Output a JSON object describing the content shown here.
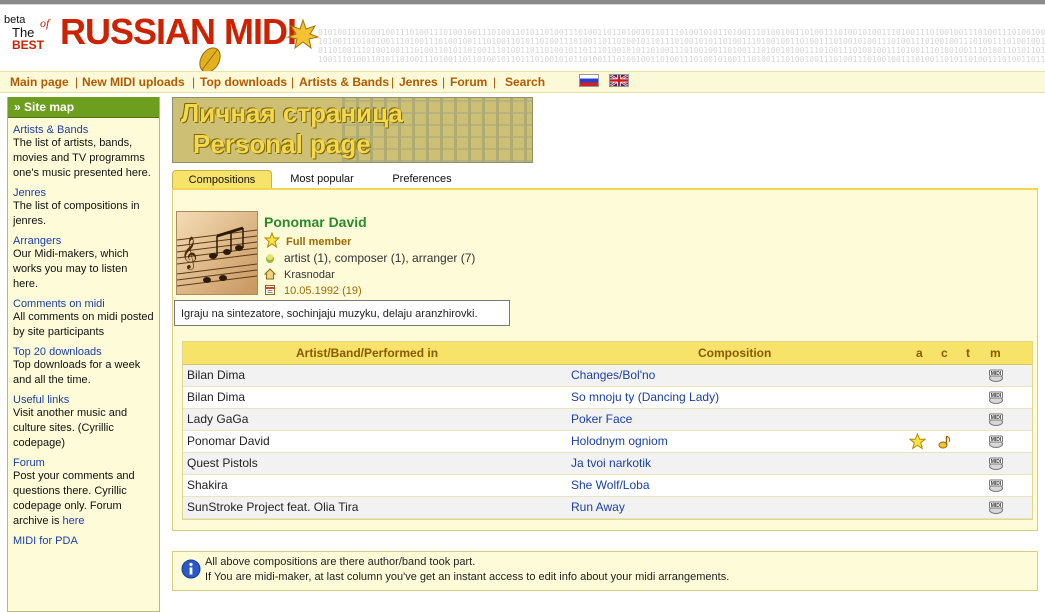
{
  "header": {
    "beta": "beta",
    "the": "The",
    "of": "of",
    "best": "BEST",
    "title": "RUSSIAN MIDI"
  },
  "nav": {
    "items": [
      "Main page",
      "New MIDI uploads",
      "Top downloads",
      "Artists & Bands",
      "Jenres",
      "Forum",
      "Search"
    ],
    "flags": [
      "ru-flag-icon",
      "uk-flag-icon"
    ]
  },
  "sidebar": {
    "title": "» Site map",
    "items": [
      {
        "title": "Artists & Bands",
        "desc": "The list of artists, bands, movies and TV programms one's music presented here."
      },
      {
        "title": "Jenres",
        "desc": "The list of compositions in jenres."
      },
      {
        "title": "Arrangers",
        "desc": "Our Midi-makers, which works you may to listen here."
      },
      {
        "title": "Comments on midi",
        "desc": "All comments on midi posted by site participants"
      },
      {
        "title": "Top 20 downloads",
        "desc": "Top downloads for a week and all the time."
      },
      {
        "title": "Useful links",
        "desc": "Visit another music and culture sites. (Cyrillic codepage)"
      },
      {
        "title": "Forum",
        "desc_pre": "Post your comments and questions there. Cyrillic codepage only. Forum archive is",
        "desc_link": "here"
      },
      {
        "title": "MIDI for PDA",
        "desc": ""
      }
    ]
  },
  "banner": {
    "ru": "Личная страница",
    "en": "Personal page"
  },
  "tabs": [
    "Compositions",
    "Most popular",
    "Preferences"
  ],
  "profile": {
    "name": "Ponomar David",
    "status": "Full member",
    "roles": "artist (1), composer (1), arranger (7)",
    "city": "Krasnodar",
    "date": "10.05.1992 (19)",
    "bio": "Igraju na sintezatore, sochinjaju muzyku, delaju aranzhirovki."
  },
  "table": {
    "headers": {
      "artist": "Artist/Band/Performed in",
      "composition": "Composition",
      "a": "a",
      "c": "c",
      "t": "t",
      "m": "m"
    },
    "rows": [
      {
        "artist": "Bilan Dima",
        "composition": "Changes/Bol'no",
        "star": false
      },
      {
        "artist": "Bilan Dima",
        "composition": "So mnoju ty (Dancing Lady)",
        "star": false
      },
      {
        "artist": "Lady GaGa",
        "composition": "Poker Face",
        "star": false
      },
      {
        "artist": "Ponomar David",
        "composition": "Holodnym ogniom",
        "star": true
      },
      {
        "artist": "Quest Pistols",
        "composition": "Ja tvoi narkotik",
        "star": false
      },
      {
        "artist": "Shakira",
        "composition": "She Wolf/Loba",
        "star": false
      },
      {
        "artist": "SunStroke Project feat. Olia Tira",
        "composition": "Run Away",
        "star": false
      }
    ]
  },
  "info": {
    "line1": "All above compositions are there author/band took part.",
    "line2": "If You are midi-maker, at last column you've get an instant access to edit info about your midi arrangements."
  }
}
